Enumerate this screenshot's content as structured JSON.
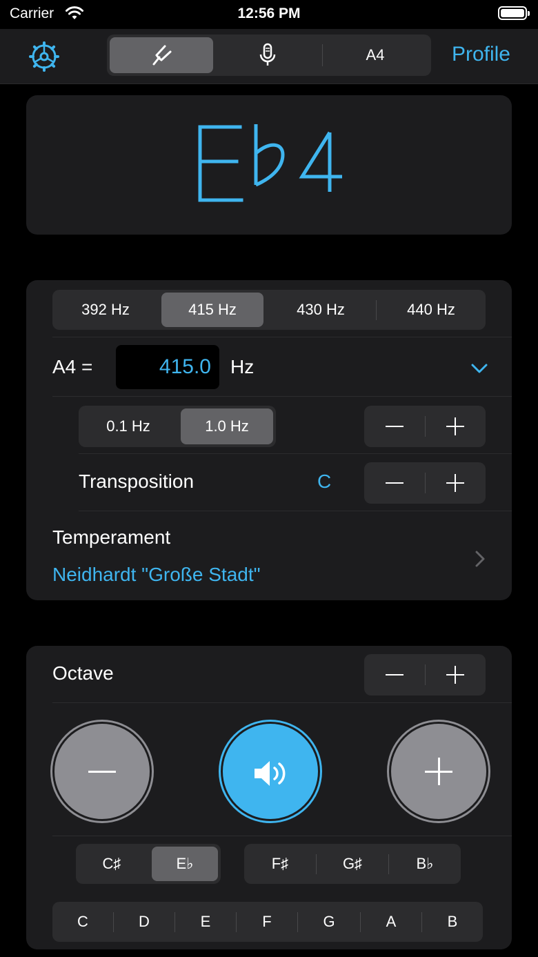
{
  "status_bar": {
    "carrier": "Carrier",
    "time": "12:56 PM"
  },
  "nav": {
    "tabs": [
      {
        "icon": "tuning-fork-icon",
        "selected": true
      },
      {
        "icon": "microphone-icon",
        "selected": false
      },
      {
        "label": "A4",
        "selected": false
      }
    ],
    "profile_label": "Profile"
  },
  "note": {
    "letter": "E",
    "accidental": "b",
    "octave": "4"
  },
  "reference": {
    "presets": [
      "392 Hz",
      "415 Hz",
      "430 Hz",
      "440 Hz"
    ],
    "selected_preset": "415 Hz",
    "a4_label": "A4 =",
    "a4_value": "415.0",
    "unit": "Hz",
    "step_options": [
      "0.1 Hz",
      "1.0 Hz"
    ],
    "selected_step": "1.0 Hz",
    "transposition_label": "Transposition",
    "transposition_value": "C",
    "temperament_label": "Temperament",
    "temperament_value": "Neidhardt \"Große Stadt\""
  },
  "octave": {
    "label": "Octave",
    "accidentals_left": [
      "C♯",
      "E♭"
    ],
    "selected_accidental": "E♭",
    "accidentals_right": [
      "F♯",
      "G♯",
      "B♭"
    ],
    "naturals": [
      "C",
      "D",
      "E",
      "F",
      "G",
      "A",
      "B"
    ]
  },
  "colors": {
    "accent": "#3fb5ef",
    "card": "#1c1c1e",
    "control": "#2c2c2e",
    "selected": "#636366"
  }
}
